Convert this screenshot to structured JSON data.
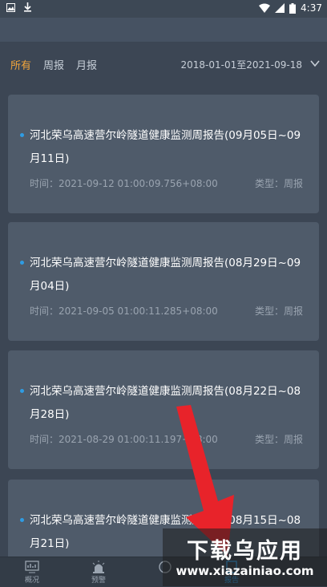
{
  "status_bar": {
    "time": "4:37"
  },
  "filters": {
    "tabs": [
      {
        "label": "所有",
        "active": true
      },
      {
        "label": "周报",
        "active": false
      },
      {
        "label": "月报",
        "active": false
      }
    ],
    "date_range": "2018-01-01至2021-09-18"
  },
  "reports": [
    {
      "title": "河北荣乌高速营尔岭隧道健康监测周报告(09月05日~09月11日)",
      "time": "时间：2021-09-12 01:00:09.756+08:00",
      "type": "类型：周报"
    },
    {
      "title": "河北荣乌高速营尔岭隧道健康监测周报告(08月29日~09月04日)",
      "time": "时间：2021-09-05 01:00:11.285+08:00",
      "type": "类型：周报"
    },
    {
      "title": "河北荣乌高速营尔岭隧道健康监测周报告(08月22日~08月28日)",
      "time": "时间：2021-08-29 01:00:11.197+08:00",
      "type": "类型：周报"
    },
    {
      "title": "河北荣乌高速营尔岭隧道健康监测周报告(08月15日~08月21日)",
      "time": "",
      "type": ""
    }
  ],
  "bottom_nav": [
    {
      "label": "概况",
      "icon": "overview-icon"
    },
    {
      "label": "预警",
      "icon": "alarm-icon"
    },
    {
      "label": "",
      "icon": "monitor-icon"
    },
    {
      "label": "报告",
      "icon": "report-icon",
      "active": true
    }
  ],
  "watermark": {
    "text": "下载乌应用",
    "url": "www.xiazainiao.com"
  },
  "colors": {
    "accent": "#f0a43b",
    "dot": "#2f9ce3",
    "card": "#4f5b6a",
    "arrow": "#e8232a"
  }
}
